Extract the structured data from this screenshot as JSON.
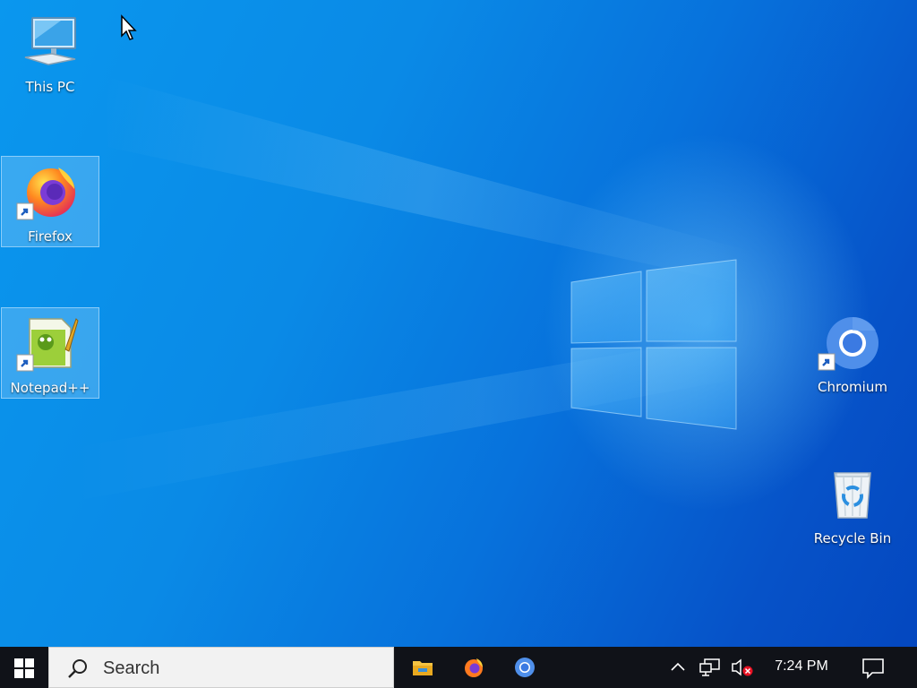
{
  "desktop": {
    "icons": [
      {
        "id": "this-pc",
        "label": "This PC"
      },
      {
        "id": "firefox",
        "label": "Firefox"
      },
      {
        "id": "notepadpp",
        "label": "Notepad++"
      },
      {
        "id": "chromium",
        "label": "Chromium"
      },
      {
        "id": "recycle-bin",
        "label": "Recycle Bin"
      }
    ]
  },
  "taskbar": {
    "search_placeholder": "Search",
    "pinned": [
      "file-explorer-icon",
      "firefox-icon",
      "chromium-icon"
    ],
    "clock": "7:24 PM"
  },
  "colors": {
    "taskbar_bg": "#101218",
    "desktop_accent": "#0a8ae6"
  }
}
